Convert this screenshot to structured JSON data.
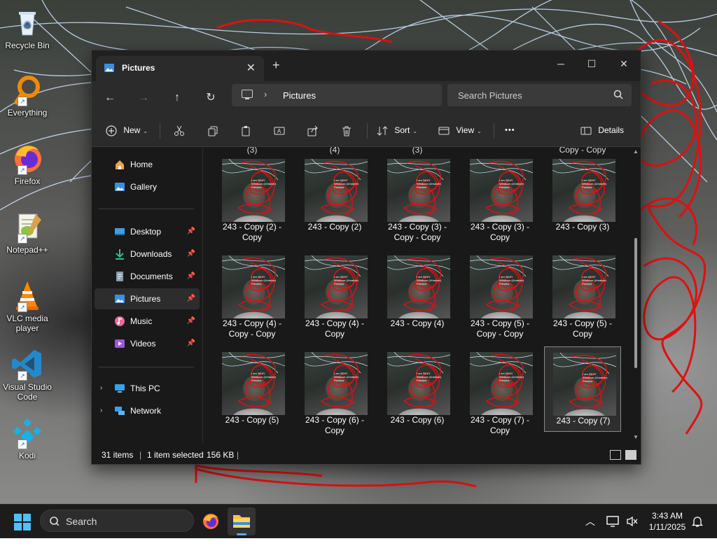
{
  "desktop": {
    "icons": [
      {
        "label": "Recycle Bin",
        "icon": "recycle-bin-icon"
      },
      {
        "label": "Everything",
        "icon": "everything-search-icon"
      },
      {
        "label": "Firefox",
        "icon": "firefox-icon"
      },
      {
        "label": "Notepad++",
        "icon": "notepad-plus-plus-icon"
      },
      {
        "label": "VLC media player",
        "icon": "vlc-icon"
      },
      {
        "label": "Visual Studio Code",
        "icon": "vscode-icon"
      },
      {
        "label": "Kodi",
        "icon": "kodi-icon"
      }
    ]
  },
  "window": {
    "tab_title": "Pictures",
    "controls": {
      "minimize": "─",
      "maximize": "☐",
      "close": "✕"
    },
    "address": {
      "crumb": "Pictures"
    },
    "search": {
      "placeholder": "Search Pictures"
    },
    "toolbar": {
      "new_label": "New",
      "sort_label": "Sort",
      "view_label": "View",
      "more_label": "•••",
      "details_label": "Details"
    },
    "nav": {
      "home": "Home",
      "gallery": "Gallery",
      "quick": [
        {
          "label": "Desktop",
          "pinned": true
        },
        {
          "label": "Downloads",
          "pinned": true
        },
        {
          "label": "Documents",
          "pinned": true
        },
        {
          "label": "Pictures",
          "pinned": true,
          "selected": true
        },
        {
          "label": "Music",
          "pinned": true
        },
        {
          "label": "Videos",
          "pinned": true
        }
      ],
      "this_pc": "This PC",
      "network": "Network"
    },
    "partial_row_labels": [
      "(3)",
      "(4)",
      "(3)",
      "",
      "Copy - Copy"
    ],
    "thumbnail_watermark": [
      "I am SEXY",
      "Windows (Unraider)",
      "Preview"
    ],
    "files": [
      {
        "name": "243 - Copy (2) - Copy"
      },
      {
        "name": "243 - Copy (2)"
      },
      {
        "name": "243 - Copy (3) - Copy - Copy"
      },
      {
        "name": "243 - Copy (3) - Copy"
      },
      {
        "name": "243 - Copy (3)"
      },
      {
        "name": "243 - Copy (4) - Copy - Copy"
      },
      {
        "name": "243 - Copy (4) - Copy"
      },
      {
        "name": "243 - Copy (4)"
      },
      {
        "name": "243 - Copy (5) - Copy - Copy"
      },
      {
        "name": "243 - Copy (5) - Copy"
      },
      {
        "name": "243 - Copy (5)"
      },
      {
        "name": "243 - Copy (6) - Copy"
      },
      {
        "name": "243 - Copy (6)"
      },
      {
        "name": "243 - Copy (7) - Copy"
      },
      {
        "name": "243 - Copy (7)",
        "selected": true
      }
    ],
    "status": {
      "items": "31 items",
      "selected": "1 item selected",
      "size": "156 KB"
    }
  },
  "taskbar": {
    "search_label": "Search",
    "time": "3:43 AM",
    "date": "1/11/2025"
  }
}
